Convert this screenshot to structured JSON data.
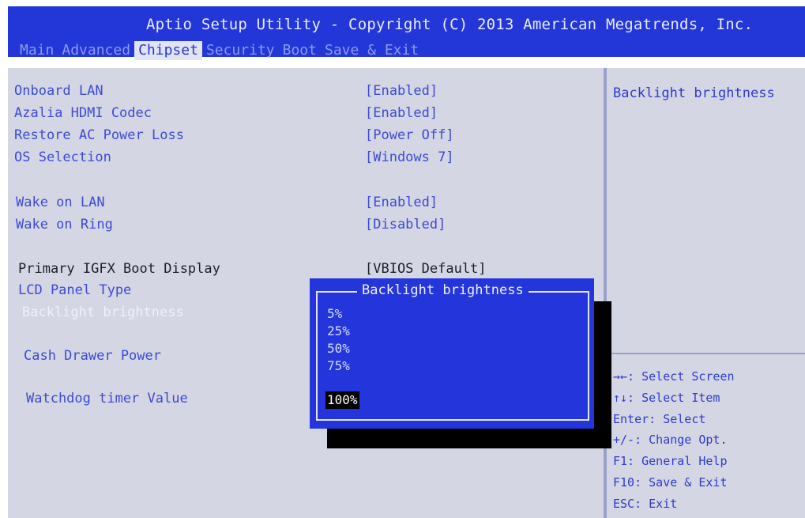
{
  "header": {
    "title": "Aptio Setup Utility - Copyright (C) 2013 American Megatrends, Inc.",
    "tabs": [
      "Main",
      "Advanced",
      "Chipset",
      "Security",
      "Boot",
      "Save & Exit"
    ],
    "active_tab": "Chipset"
  },
  "settings": [
    {
      "label": "Onboard LAN",
      "value": "[Enabled]"
    },
    {
      "label": "Azalia HDMI Codec",
      "value": "[Enabled]"
    },
    {
      "label": "Restore AC Power Loss",
      "value": "[Power Off]"
    },
    {
      "label": "OS Selection",
      "value": "[Windows 7]"
    },
    {
      "label": "Wake on LAN",
      "value": "[Enabled]"
    },
    {
      "label": "Wake on Ring",
      "value": "[Disabled]"
    },
    {
      "label": "Primary IGFX Boot Display",
      "value": "[VBIOS Default]"
    },
    {
      "label": "LCD Panel Type",
      "value": ""
    },
    {
      "label": "Backlight brightness",
      "value": ""
    },
    {
      "label": "Cash Drawer Power",
      "value": ""
    },
    {
      "label": "Watchdog timer Value",
      "value": ""
    }
  ],
  "help": {
    "description": "Backlight brightness",
    "keys": [
      "→←: Select Screen",
      "↑↓: Select Item",
      "Enter: Select",
      "+/-: Change Opt.",
      "F1: General Help",
      "F10: Save & Exit",
      "ESC: Exit"
    ]
  },
  "popup": {
    "title": "Backlight brightness",
    "options": [
      "5%",
      "25%",
      "50%",
      "75%",
      "100%"
    ],
    "selected": "100%"
  },
  "colors": {
    "header_blue": "#2337d8",
    "panel_gray": "#d4d6e3",
    "popup_blue": "#2436db",
    "label_blue": "#3b4bd4"
  }
}
